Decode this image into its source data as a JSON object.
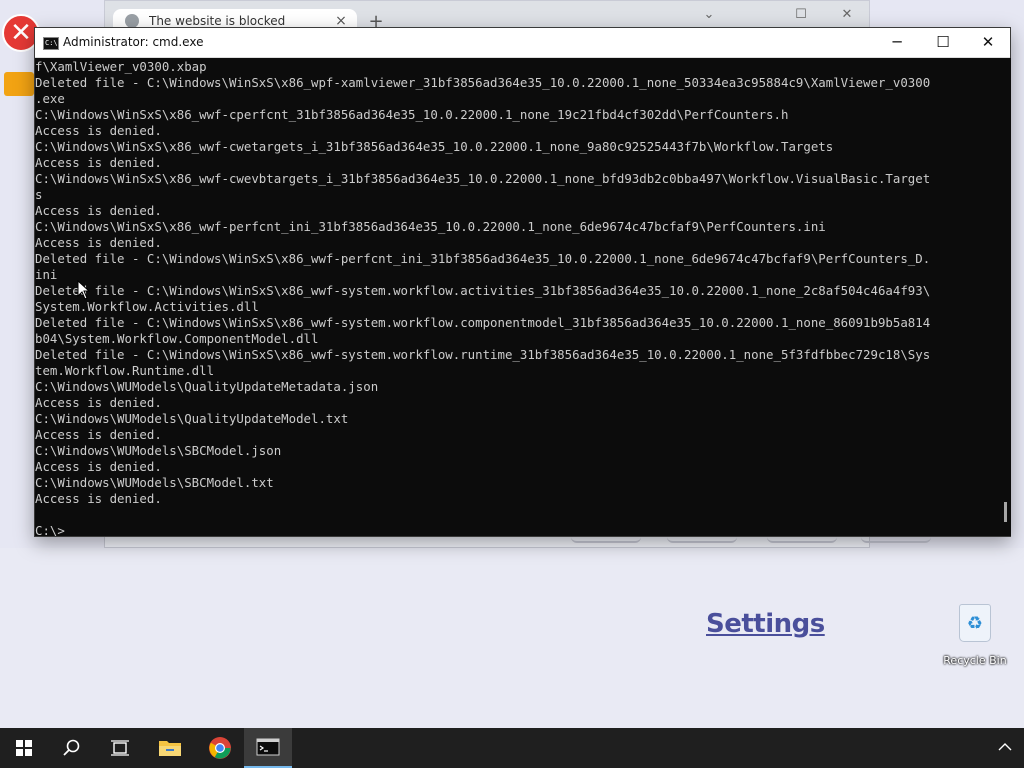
{
  "browser": {
    "tab_title": "The website is blocked",
    "tab_close": "×",
    "new_tab": "+",
    "controls": {
      "collapse": "⌄",
      "maximize": "☐",
      "close": "✕"
    }
  },
  "desktop": {
    "settings_label": "Settings",
    "recycle_bin_label": "Recycle Bin"
  },
  "cmd": {
    "title": "Administrator: cmd.exe",
    "icon_text": "C:\\",
    "minimize": "─",
    "maximize": "☐",
    "close": "✕",
    "lines": [
      "f\\XamlViewer_v0300.xbap",
      "Deleted file - C:\\Windows\\WinSxS\\x86_wpf-xamlviewer_31bf3856ad364e35_10.0.22000.1_none_50334ea3c95884c9\\XamlViewer_v0300",
      ".exe",
      "C:\\Windows\\WinSxS\\x86_wwf-cperfcnt_31bf3856ad364e35_10.0.22000.1_none_19c21fbd4cf302dd\\PerfCounters.h",
      "Access is denied.",
      "C:\\Windows\\WinSxS\\x86_wwf-cwetargets_i_31bf3856ad364e35_10.0.22000.1_none_9a80c92525443f7b\\Workflow.Targets",
      "Access is denied.",
      "C:\\Windows\\WinSxS\\x86_wwf-cwevbtargets_i_31bf3856ad364e35_10.0.22000.1_none_bfd93db2c0bba497\\Workflow.VisualBasic.Target",
      "s",
      "Access is denied.",
      "C:\\Windows\\WinSxS\\x86_wwf-perfcnt_ini_31bf3856ad364e35_10.0.22000.1_none_6de9674c47bcfaf9\\PerfCounters.ini",
      "Access is denied.",
      "Deleted file - C:\\Windows\\WinSxS\\x86_wwf-perfcnt_ini_31bf3856ad364e35_10.0.22000.1_none_6de9674c47bcfaf9\\PerfCounters_D.",
      "ini",
      "Deleted file - C:\\Windows\\WinSxS\\x86_wwf-system.workflow.activities_31bf3856ad364e35_10.0.22000.1_none_2c8af504c46a4f93\\",
      "System.Workflow.Activities.dll",
      "Deleted file - C:\\Windows\\WinSxS\\x86_wwf-system.workflow.componentmodel_31bf3856ad364e35_10.0.22000.1_none_86091b9b5a814",
      "b04\\System.Workflow.ComponentModel.dll",
      "Deleted file - C:\\Windows\\WinSxS\\x86_wwf-system.workflow.runtime_31bf3856ad364e35_10.0.22000.1_none_5f3fdfbbec729c18\\Sys",
      "tem.Workflow.Runtime.dll",
      "C:\\Windows\\WUModels\\QualityUpdateMetadata.json",
      "Access is denied.",
      "C:\\Windows\\WUModels\\QualityUpdateModel.txt",
      "Access is denied.",
      "C:\\Windows\\WUModels\\SBCModel.json",
      "Access is denied.",
      "C:\\Windows\\WUModels\\SBCModel.txt",
      "Access is denied.",
      "",
      "C:\\>"
    ]
  },
  "taskbar": {
    "items": [
      {
        "name": "start-button",
        "icon": "windows-logo-icon"
      },
      {
        "name": "search-button",
        "icon": "search-icon"
      },
      {
        "name": "task-view-button",
        "icon": "task-view-icon"
      },
      {
        "name": "file-explorer-button",
        "icon": "folder-icon"
      },
      {
        "name": "chrome-button",
        "icon": "chrome-icon"
      },
      {
        "name": "cmd-button",
        "icon": "terminal-icon"
      }
    ],
    "tray_chevron": "^"
  },
  "colors": {
    "cmd_background": "#0c0c0c",
    "cmd_text": "#cccccc",
    "taskbar": "#1f1f1f",
    "desktop": "#e6e7f3",
    "settings_link": "#4a4f9b",
    "blocked_red": "#e53935"
  }
}
